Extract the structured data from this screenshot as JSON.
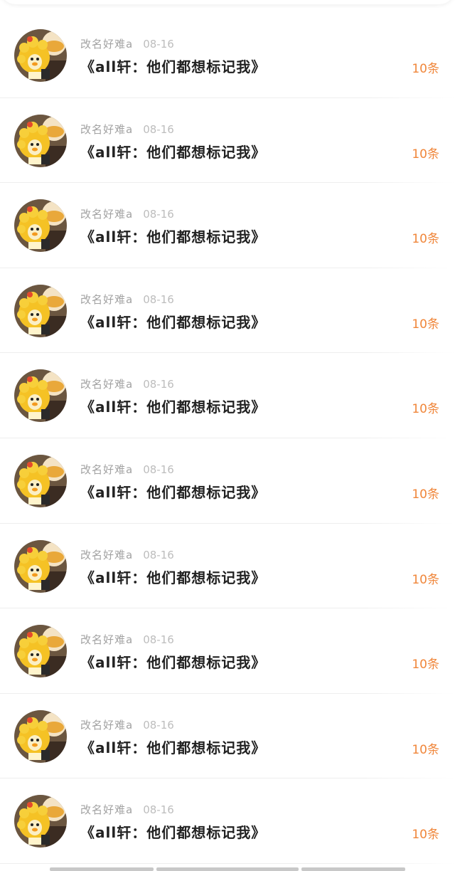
{
  "colors": {
    "background": "#ffffff",
    "username": "#a2a2a2",
    "date": "#bdbdbd",
    "title": "#222222",
    "count_accent": "#f0863a",
    "divider": "#eeeeee"
  },
  "list": {
    "items": [
      {
        "username": "改名好难a",
        "date": "08-16",
        "title": "《all轩：他们都想标记我》",
        "count": "10条",
        "avatar_icon": "duckling-avatar"
      },
      {
        "username": "改名好难a",
        "date": "08-16",
        "title": "《all轩：他们都想标记我》",
        "count": "10条",
        "avatar_icon": "duckling-avatar"
      },
      {
        "username": "改名好难a",
        "date": "08-16",
        "title": "《all轩：他们都想标记我》",
        "count": "10条",
        "avatar_icon": "duckling-avatar"
      },
      {
        "username": "改名好难a",
        "date": "08-16",
        "title": "《all轩：他们都想标记我》",
        "count": "10条",
        "avatar_icon": "duckling-avatar"
      },
      {
        "username": "改名好难a",
        "date": "08-16",
        "title": "《all轩：他们都想标记我》",
        "count": "10条",
        "avatar_icon": "duckling-avatar"
      },
      {
        "username": "改名好难a",
        "date": "08-16",
        "title": "《all轩：他们都想标记我》",
        "count": "10条",
        "avatar_icon": "duckling-avatar"
      },
      {
        "username": "改名好难a",
        "date": "08-16",
        "title": "《all轩：他们都想标记我》",
        "count": "10条",
        "avatar_icon": "duckling-avatar"
      },
      {
        "username": "改名好难a",
        "date": "08-16",
        "title": "《all轩：他们都想标记我》",
        "count": "10条",
        "avatar_icon": "duckling-avatar"
      },
      {
        "username": "改名好难a",
        "date": "08-16",
        "title": "《all轩：他们都想标记我》",
        "count": "10条",
        "avatar_icon": "duckling-avatar"
      },
      {
        "username": "改名好难a",
        "date": "08-16",
        "title": "《all轩：他们都想标记我》",
        "count": "10条",
        "avatar_icon": "duckling-avatar"
      }
    ]
  }
}
